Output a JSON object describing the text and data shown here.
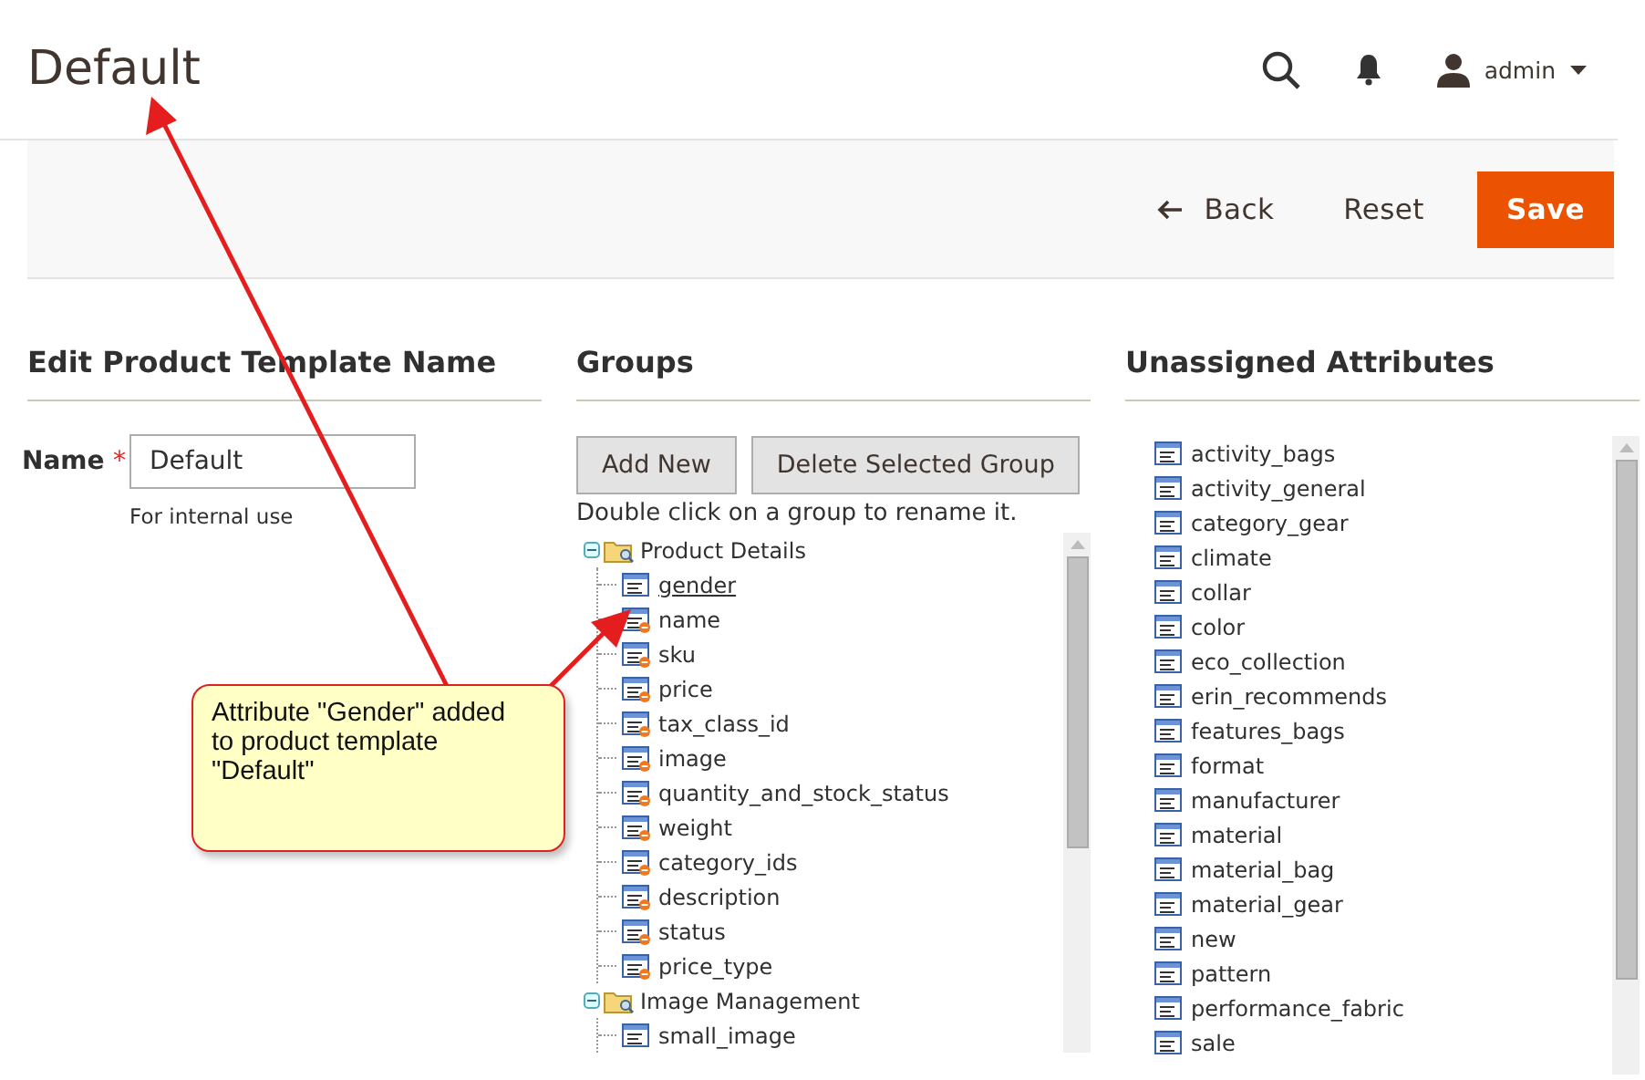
{
  "header": {
    "title": "Default",
    "user": "admin"
  },
  "actions": [
    {
      "label": "Back",
      "kind": "back"
    },
    {
      "label": "Reset",
      "kind": "plain"
    },
    {
      "label": "Save",
      "kind": "primary"
    }
  ],
  "name_section": {
    "heading": "Edit Product Template Name",
    "label": "Name",
    "required_mark": "*",
    "value": "Default",
    "note": "For internal use"
  },
  "groups": {
    "heading": "Groups",
    "buttons": [
      "Add New",
      "Delete Selected Group"
    ],
    "hint": "Double click on a group to rename it.",
    "tree": [
      {
        "label": "Product Details",
        "expanded": true,
        "children": [
          {
            "label": "gender",
            "kind": "custom",
            "selected": true
          },
          {
            "label": "name",
            "kind": "system",
            "selected": false
          },
          {
            "label": "sku",
            "kind": "system",
            "selected": false
          },
          {
            "label": "price",
            "kind": "system",
            "selected": false
          },
          {
            "label": "tax_class_id",
            "kind": "system",
            "selected": false
          },
          {
            "label": "image",
            "kind": "system",
            "selected": false
          },
          {
            "label": "quantity_and_stock_status",
            "kind": "system",
            "selected": false
          },
          {
            "label": "weight",
            "kind": "system",
            "selected": false
          },
          {
            "label": "category_ids",
            "kind": "system",
            "selected": false
          },
          {
            "label": "description",
            "kind": "system",
            "selected": false
          },
          {
            "label": "status",
            "kind": "system",
            "selected": false
          },
          {
            "label": "price_type",
            "kind": "system",
            "selected": false
          }
        ]
      },
      {
        "label": "Image Management",
        "expanded": true,
        "children": [
          {
            "label": "small_image",
            "kind": "custom",
            "selected": false
          }
        ]
      }
    ]
  },
  "unassigned": {
    "heading": "Unassigned Attributes",
    "items": [
      "activity_bags",
      "activity_general",
      "category_gear",
      "climate",
      "collar",
      "color",
      "eco_collection",
      "erin_recommends",
      "features_bags",
      "format",
      "manufacturer",
      "material",
      "material_bag",
      "material_gear",
      "new",
      "pattern",
      "performance_fabric",
      "sale"
    ]
  },
  "annotation": {
    "text": "Attribute \"Gender\" added to product template \"Default\""
  }
}
